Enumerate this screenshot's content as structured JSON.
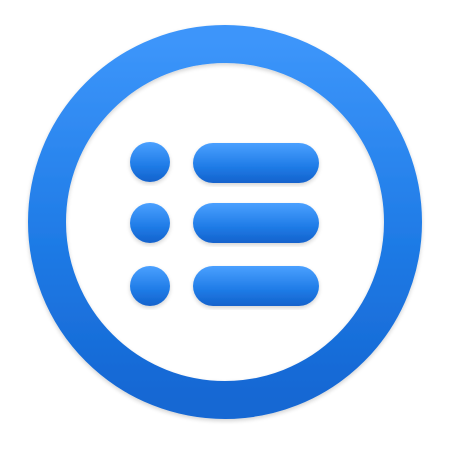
{
  "icon": {
    "semantic_name": "list-menu-icon",
    "colors": {
      "primary": "#1F7BE6",
      "highlight": "#4DA3FF",
      "shadow": "#0F5BC4",
      "background": "#FFFFFF"
    }
  }
}
